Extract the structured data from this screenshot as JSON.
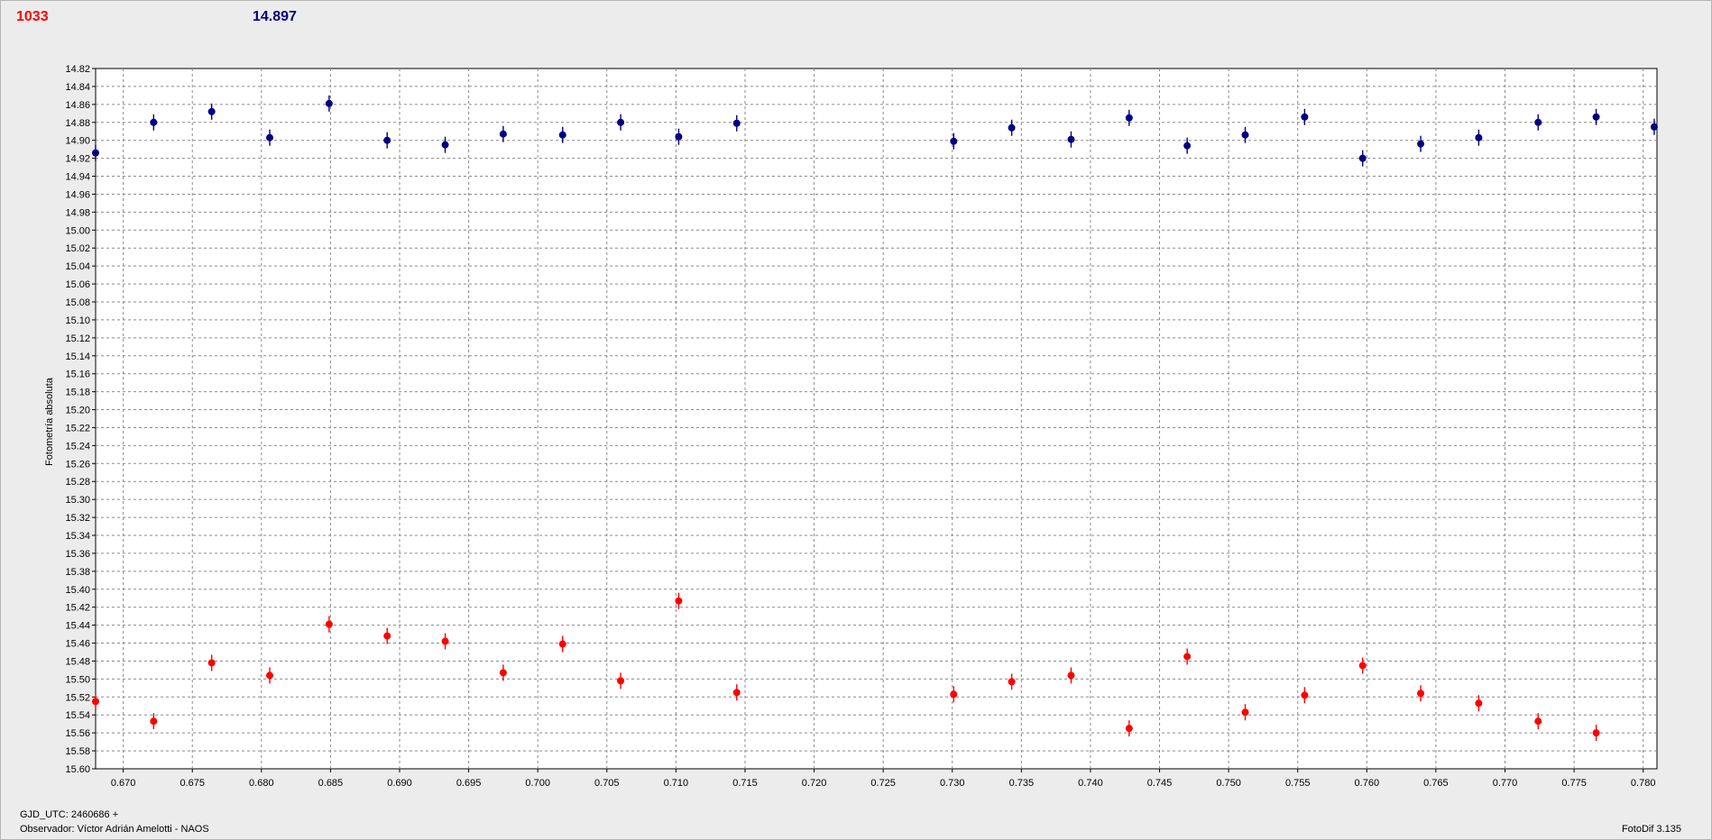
{
  "header": {
    "left_value": "1033",
    "right_value": "14.897",
    "left_color": "#ff0000",
    "right_color": "#000080"
  },
  "footer": {
    "gjd_label": "GJD_UTC: 2460686 +",
    "observer_label": "Observador: Víctor Adrián Amelotti - NAOS",
    "version_label": "FotoDif 3.135"
  },
  "chart_data": {
    "type": "scatter",
    "title": "",
    "xlabel": "",
    "ylabel": "Fotometría absoluta",
    "xlim": [
      0.668,
      0.781
    ],
    "ylim": [
      14.82,
      15.6
    ],
    "y_inverted": true,
    "grid": true,
    "x_ticks": [
      "0.670",
      "0.675",
      "0.680",
      "0.685",
      "0.690",
      "0.695",
      "0.700",
      "0.705",
      "0.710",
      "0.715",
      "0.720",
      "0.725",
      "0.730",
      "0.735",
      "0.740",
      "0.745",
      "0.750",
      "0.755",
      "0.760",
      "0.765",
      "0.770",
      "0.775",
      "0.780"
    ],
    "y_ticks": [
      "14.82",
      "14.84",
      "14.86",
      "14.88",
      "14.90",
      "14.92",
      "14.94",
      "14.96",
      "14.98",
      "15.00",
      "15.02",
      "15.04",
      "15.06",
      "15.08",
      "15.10",
      "15.12",
      "15.14",
      "15.16",
      "15.18",
      "15.20",
      "15.22",
      "15.24",
      "15.26",
      "15.28",
      "15.30",
      "15.32",
      "15.34",
      "15.36",
      "15.38",
      "15.40",
      "15.42",
      "15.44",
      "15.46",
      "15.48",
      "15.50",
      "15.52",
      "15.54",
      "15.56",
      "15.58",
      "15.60"
    ],
    "x": [
      0.668,
      0.6722,
      0.6764,
      0.6806,
      0.6849,
      0.6891,
      0.6933,
      0.6975,
      0.7018,
      0.706,
      0.7102,
      0.7144,
      0.7301,
      0.7343,
      0.7386,
      0.7428,
      0.747,
      0.7512,
      0.7555,
      0.7597,
      0.7639,
      0.7681,
      0.7724,
      0.7766,
      0.7808
    ],
    "series": [
      {
        "color": "#000080",
        "values": [
          14.914,
          14.88,
          14.868,
          14.897,
          14.859,
          14.9,
          14.905,
          14.893,
          14.894,
          14.88,
          14.896,
          14.881,
          14.901,
          14.886,
          14.899,
          14.875,
          14.906,
          14.894,
          14.874,
          14.92,
          14.904,
          14.897,
          14.88,
          14.874,
          14.885
        ]
      },
      {
        "color": "#ff0000",
        "values": [
          15.525,
          15.547,
          15.482,
          15.496,
          15.439,
          15.452,
          15.458,
          15.493,
          15.461,
          15.502,
          15.413,
          15.515,
          15.517,
          15.503,
          15.496,
          15.555,
          15.475,
          15.537,
          15.518,
          15.485,
          15.516,
          15.527,
          15.547,
          15.56
        ]
      }
    ]
  }
}
